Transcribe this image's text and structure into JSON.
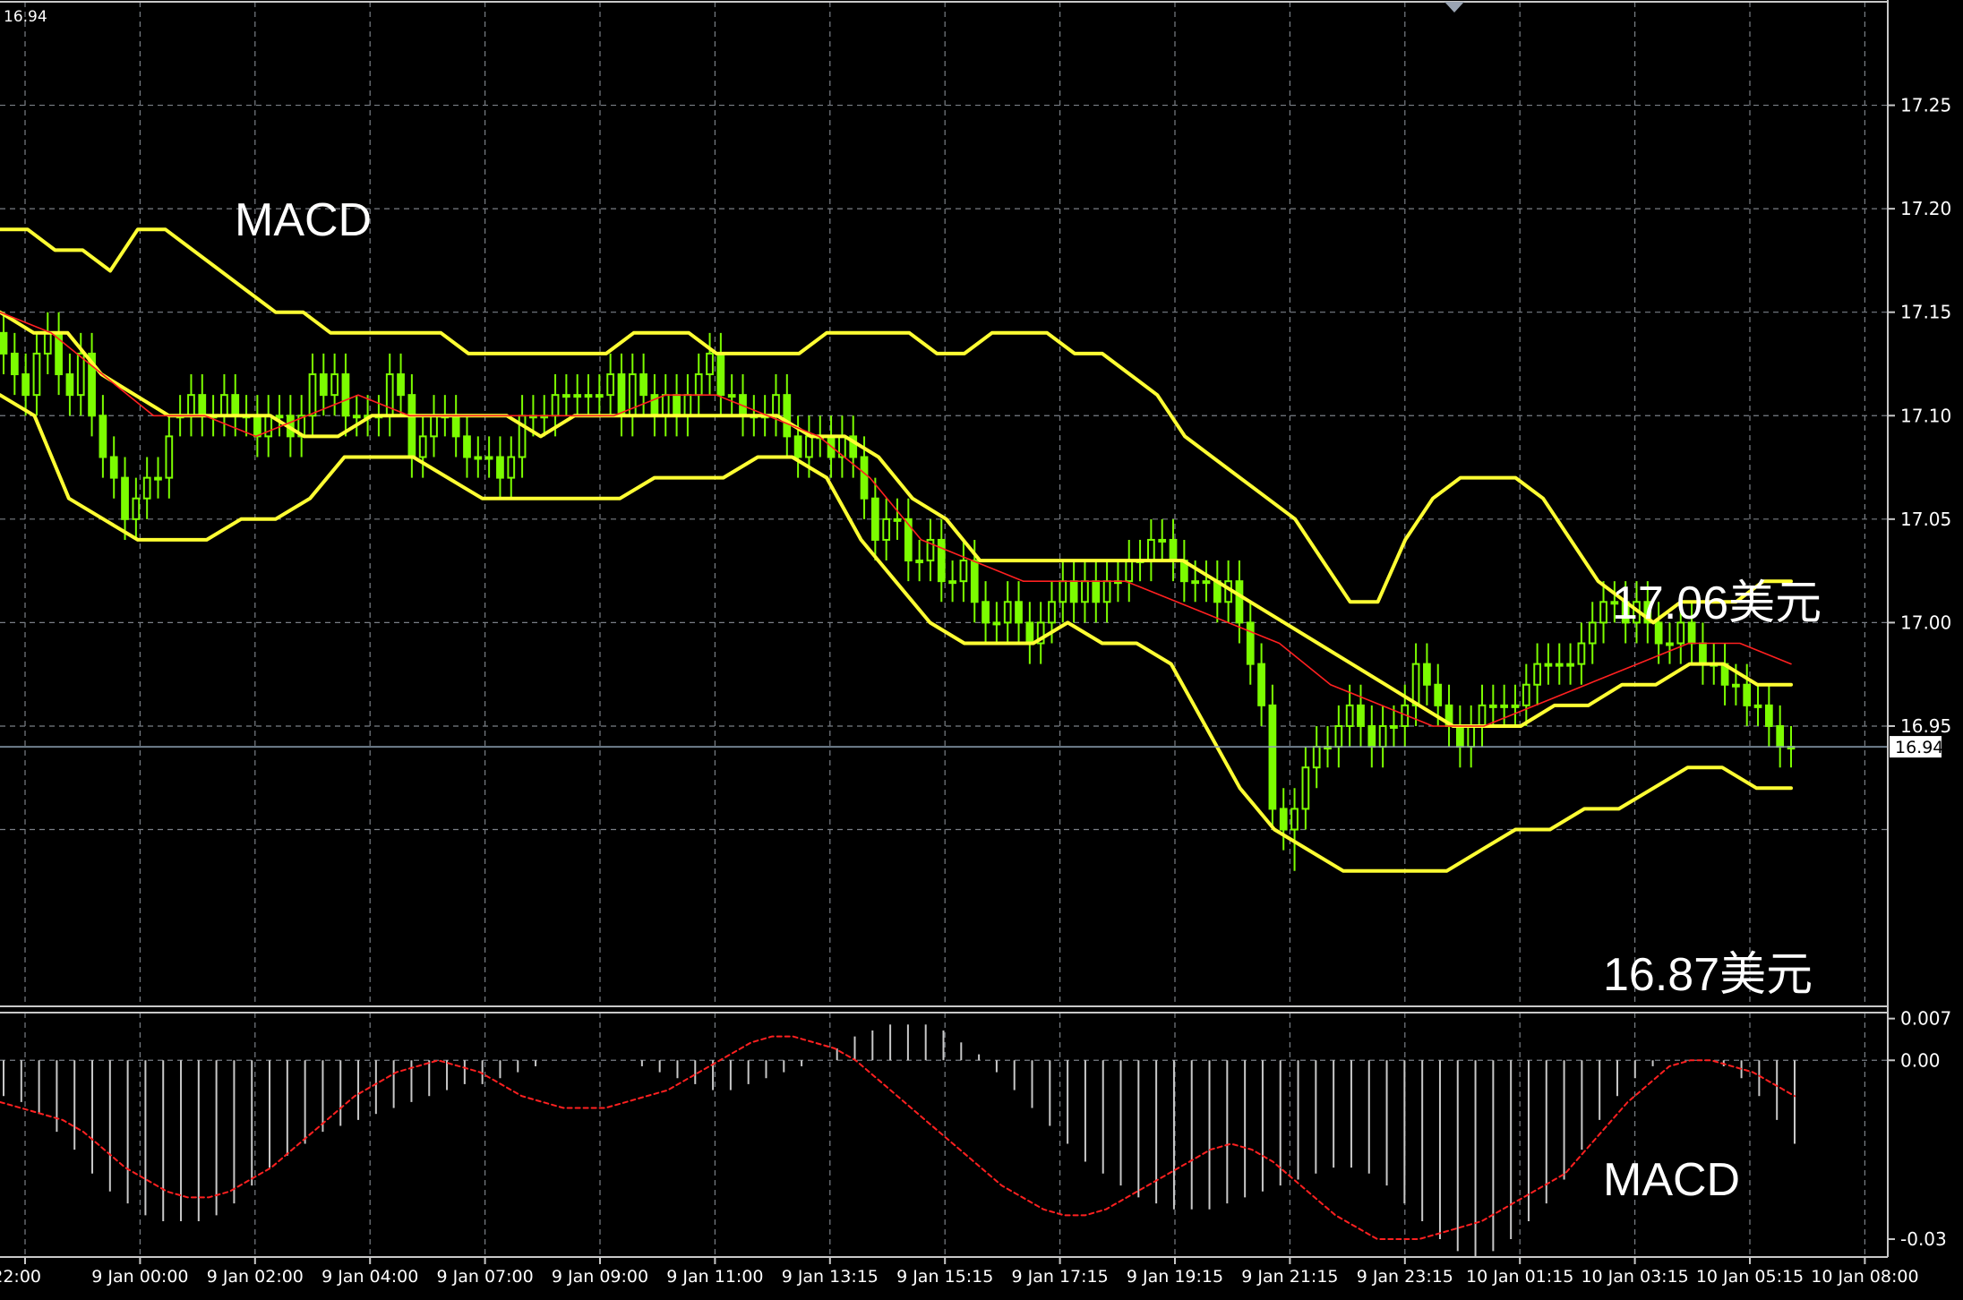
{
  "colors": {
    "background": "#000000",
    "grid": "#7a7f86",
    "frame": "#c8c8c8",
    "axis_text": "#ffffff",
    "candle": "#7CFC00",
    "bollinger": "#ffff33",
    "ma": "#ff2020",
    "histogram": "#c8c8c8",
    "signal": "#ff2020",
    "price_line": "#8fa3b5",
    "label": "#ffffff"
  },
  "annotations": {
    "macd_top": "MACD",
    "upper_price": "17.06美元",
    "lower_price": "16.87美元",
    "macd_bottom": "MACD"
  },
  "chart_data": [
    {
      "type": "candlestick",
      "corner_label": "16.94",
      "current_price": 16.94,
      "current_price_label": "16.94",
      "ylim": [
        16.815,
        17.3
      ],
      "yticks": [
        17.25,
        17.2,
        17.15,
        17.1,
        17.05,
        17.0,
        16.95
      ],
      "ytick_labels": [
        "17.25",
        "17.20",
        "17.15",
        "17.10",
        "17.05",
        "17.00",
        "16.95"
      ],
      "x_labels": [
        "22:00",
        "9 Jan 00:00",
        "9 Jan 02:00",
        "9 Jan 04:00",
        "9 Jan 07:00",
        "9 Jan 09:00",
        "9 Jan 11:00",
        "9 Jan 13:15",
        "9 Jan 15:15",
        "9 Jan 17:15",
        "9 Jan 19:15",
        "9 Jan 21:15",
        "9 Jan 23:15",
        "10 Jan 01:15",
        "10 Jan 03:15",
        "10 Jan 05:15",
        "10 Jan 08:00"
      ],
      "candles": {
        "open": [
          17.14,
          17.13,
          17.12,
          17.11,
          17.13,
          17.14,
          17.12,
          17.11,
          17.13,
          17.1,
          17.08,
          17.07,
          17.05,
          17.06,
          17.07,
          17.07,
          17.1,
          17.1,
          17.11,
          17.1,
          17.1,
          17.11,
          17.1,
          17.1,
          17.09,
          17.1,
          17.1,
          17.09,
          17.1,
          17.12,
          17.11,
          17.12,
          17.1,
          17.1,
          17.1,
          17.1,
          17.12,
          17.11,
          17.08,
          17.09,
          17.1,
          17.1,
          17.09,
          17.08,
          17.08,
          17.08,
          17.07,
          17.08,
          17.1,
          17.1,
          17.1,
          17.11,
          17.11,
          17.11,
          17.11,
          17.11,
          17.12,
          17.1,
          17.12,
          17.11,
          17.1,
          17.11,
          17.1,
          17.11,
          17.12,
          17.13,
          17.11,
          17.11,
          17.1,
          17.1,
          17.1,
          17.11,
          17.09,
          17.08,
          17.09,
          17.09,
          17.08,
          17.09,
          17.08,
          17.06,
          17.04,
          17.05,
          17.05,
          17.03,
          17.03,
          17.04,
          17.02,
          17.02,
          17.03,
          17.01,
          17.0,
          17.0,
          17.01,
          17.0,
          16.99,
          17.0,
          17.01,
          17.02,
          17.01,
          17.02,
          17.01,
          17.02,
          17.02,
          17.03,
          17.03,
          17.04,
          17.04,
          17.03,
          17.02,
          17.02,
          17.02,
          17.01,
          17.02,
          17.0,
          16.98,
          16.96,
          16.91,
          16.9,
          16.91,
          16.93,
          16.94,
          16.94,
          16.95,
          16.96,
          16.95,
          16.94,
          16.95,
          16.95,
          16.96,
          16.98,
          16.97,
          16.96,
          16.95,
          16.94,
          16.95,
          16.96,
          16.96,
          16.96,
          16.96,
          16.97,
          16.98,
          16.98,
          16.98,
          16.98,
          16.99,
          17.0,
          17.01,
          17.01,
          17.0,
          17.01,
          17.0,
          16.99,
          16.99,
          17.0,
          16.99,
          16.98,
          16.98,
          16.97,
          16.97,
          16.96,
          16.96,
          16.95,
          16.94
        ],
        "close": [
          17.13,
          17.12,
          17.11,
          17.13,
          17.14,
          17.12,
          17.11,
          17.13,
          17.1,
          17.08,
          17.07,
          17.05,
          17.06,
          17.07,
          17.07,
          17.09,
          17.1,
          17.11,
          17.1,
          17.1,
          17.11,
          17.1,
          17.1,
          17.09,
          17.1,
          17.1,
          17.09,
          17.1,
          17.12,
          17.11,
          17.12,
          17.1,
          17.1,
          17.1,
          17.1,
          17.12,
          17.11,
          17.08,
          17.09,
          17.1,
          17.1,
          17.09,
          17.08,
          17.08,
          17.08,
          17.07,
          17.08,
          17.1,
          17.1,
          17.1,
          17.11,
          17.11,
          17.11,
          17.11,
          17.11,
          17.12,
          17.1,
          17.12,
          17.11,
          17.1,
          17.11,
          17.1,
          17.11,
          17.12,
          17.13,
          17.11,
          17.11,
          17.1,
          17.1,
          17.1,
          17.11,
          17.09,
          17.08,
          17.09,
          17.09,
          17.08,
          17.09,
          17.08,
          17.06,
          17.04,
          17.05,
          17.05,
          17.03,
          17.03,
          17.04,
          17.02,
          17.02,
          17.03,
          17.01,
          17.0,
          17.0,
          17.01,
          17.0,
          16.99,
          17.0,
          17.01,
          17.02,
          17.01,
          17.02,
          17.01,
          17.02,
          17.02,
          17.03,
          17.03,
          17.04,
          17.04,
          17.03,
          17.02,
          17.02,
          17.02,
          17.01,
          17.02,
          17.0,
          16.98,
          16.96,
          16.91,
          16.9,
          16.91,
          16.93,
          16.94,
          16.94,
          16.95,
          16.96,
          16.95,
          16.94,
          16.95,
          16.95,
          16.96,
          16.98,
          16.97,
          16.96,
          16.95,
          16.94,
          16.95,
          16.96,
          16.96,
          16.96,
          16.96,
          16.97,
          16.98,
          16.98,
          16.98,
          16.98,
          16.99,
          17.0,
          17.01,
          17.01,
          17.0,
          17.01,
          17.0,
          16.99,
          16.99,
          17.0,
          16.99,
          16.98,
          16.98,
          16.97,
          16.97,
          16.96,
          16.96,
          16.95,
          16.94,
          16.94
        ],
        "high": [
          17.15,
          17.14,
          17.13,
          17.14,
          17.15,
          17.15,
          17.13,
          17.14,
          17.14,
          17.11,
          17.09,
          17.08,
          17.07,
          17.08,
          17.08,
          17.1,
          17.11,
          17.12,
          17.12,
          17.11,
          17.12,
          17.12,
          17.11,
          17.11,
          17.11,
          17.11,
          17.11,
          17.11,
          17.13,
          17.13,
          17.13,
          17.13,
          17.11,
          17.11,
          17.11,
          17.13,
          17.13,
          17.12,
          17.1,
          17.11,
          17.11,
          17.11,
          17.1,
          17.09,
          17.09,
          17.09,
          17.09,
          17.11,
          17.11,
          17.11,
          17.12,
          17.12,
          17.12,
          17.12,
          17.12,
          17.13,
          17.13,
          17.13,
          17.13,
          17.12,
          17.12,
          17.12,
          17.12,
          17.13,
          17.14,
          17.14,
          17.12,
          17.12,
          17.11,
          17.11,
          17.12,
          17.12,
          17.1,
          17.1,
          17.1,
          17.1,
          17.1,
          17.1,
          17.09,
          17.07,
          17.06,
          17.06,
          17.06,
          17.04,
          17.05,
          17.05,
          17.03,
          17.04,
          17.04,
          17.02,
          17.01,
          17.02,
          17.02,
          17.01,
          17.01,
          17.02,
          17.03,
          17.03,
          17.03,
          17.03,
          17.03,
          17.03,
          17.04,
          17.04,
          17.05,
          17.05,
          17.05,
          17.04,
          17.03,
          17.03,
          17.03,
          17.03,
          17.03,
          17.01,
          16.99,
          16.97,
          16.92,
          16.92,
          16.94,
          16.95,
          16.95,
          16.96,
          16.97,
          16.97,
          16.96,
          16.96,
          16.96,
          16.97,
          16.99,
          16.99,
          16.98,
          16.97,
          16.96,
          16.96,
          16.97,
          16.97,
          16.97,
          16.97,
          16.98,
          16.99,
          16.99,
          16.99,
          16.99,
          17.0,
          17.01,
          17.02,
          17.02,
          17.02,
          17.02,
          17.02,
          17.01,
          17.0,
          17.01,
          17.01,
          17.0,
          16.99,
          16.99,
          16.98,
          16.98,
          16.97,
          16.97,
          16.96,
          16.95
        ],
        "low": [
          17.12,
          17.11,
          17.1,
          17.1,
          17.12,
          17.11,
          17.1,
          17.1,
          17.09,
          17.07,
          17.06,
          17.04,
          17.04,
          17.05,
          17.06,
          17.06,
          17.09,
          17.09,
          17.09,
          17.09,
          17.09,
          17.09,
          17.09,
          17.08,
          17.08,
          17.09,
          17.08,
          17.08,
          17.09,
          17.1,
          17.1,
          17.09,
          17.09,
          17.09,
          17.09,
          17.09,
          17.1,
          17.07,
          17.07,
          17.08,
          17.09,
          17.08,
          17.07,
          17.07,
          17.07,
          17.06,
          17.06,
          17.07,
          17.09,
          17.09,
          17.09,
          17.1,
          17.1,
          17.1,
          17.1,
          17.1,
          17.09,
          17.09,
          17.1,
          17.09,
          17.09,
          17.09,
          17.09,
          17.1,
          17.11,
          17.1,
          17.1,
          17.09,
          17.09,
          17.09,
          17.09,
          17.08,
          17.07,
          17.07,
          17.08,
          17.07,
          17.07,
          17.07,
          17.05,
          17.03,
          17.03,
          17.04,
          17.02,
          17.02,
          17.02,
          17.01,
          17.01,
          17.01,
          17.0,
          16.99,
          16.99,
          16.99,
          16.99,
          16.98,
          16.98,
          16.99,
          17.0,
          17.0,
          17.0,
          17.0,
          17.0,
          17.01,
          17.01,
          17.02,
          17.02,
          17.03,
          17.02,
          17.01,
          17.01,
          17.01,
          17.0,
          17.0,
          16.99,
          16.97,
          16.95,
          16.9,
          16.89,
          16.88,
          16.9,
          16.92,
          16.93,
          16.93,
          16.94,
          16.94,
          16.93,
          16.93,
          16.94,
          16.94,
          16.95,
          16.96,
          16.95,
          16.94,
          16.93,
          16.93,
          16.94,
          16.95,
          16.95,
          16.95,
          16.95,
          16.96,
          16.97,
          16.97,
          16.97,
          16.97,
          16.98,
          16.99,
          17.0,
          16.99,
          16.99,
          16.99,
          16.98,
          16.98,
          16.98,
          16.98,
          16.97,
          16.97,
          16.96,
          16.96,
          16.95,
          16.95,
          16.94,
          16.93,
          16.93
        ]
      },
      "bollinger_upper": [
        17.19,
        17.19,
        17.18,
        17.18,
        17.17,
        17.19,
        17.19,
        17.18,
        17.17,
        17.16,
        17.15,
        17.15,
        17.14,
        17.14,
        17.14,
        17.14,
        17.14,
        17.13,
        17.13,
        17.13,
        17.13,
        17.13,
        17.13,
        17.14,
        17.14,
        17.14,
        17.13,
        17.13,
        17.13,
        17.13,
        17.14,
        17.14,
        17.14,
        17.14,
        17.13,
        17.13,
        17.14,
        17.14,
        17.14,
        17.13,
        17.13,
        17.12,
        17.11,
        17.09,
        17.08,
        17.07,
        17.06,
        17.05,
        17.03,
        17.01,
        17.01,
        17.04,
        17.06,
        17.07,
        17.07,
        17.07,
        17.06,
        17.04,
        17.02,
        17.01,
        17.0,
        17.01,
        17.01,
        17.01,
        17.02,
        17.02
      ],
      "bollinger_middle": [
        17.15,
        17.14,
        17.14,
        17.12,
        17.11,
        17.1,
        17.1,
        17.1,
        17.1,
        17.09,
        17.09,
        17.1,
        17.1,
        17.1,
        17.1,
        17.1,
        17.09,
        17.1,
        17.1,
        17.1,
        17.1,
        17.1,
        17.1,
        17.1,
        17.09,
        17.09,
        17.08,
        17.06,
        17.05,
        17.03,
        17.03,
        17.03,
        17.03,
        17.03,
        17.03,
        17.03,
        17.02,
        17.01,
        17.0,
        16.99,
        16.98,
        16.97,
        16.96,
        16.95,
        16.95,
        16.95,
        16.96,
        16.96,
        16.97,
        16.97,
        16.98,
        16.98,
        16.97,
        16.97
      ],
      "bollinger_lower": [
        17.11,
        17.1,
        17.06,
        17.05,
        17.04,
        17.04,
        17.04,
        17.05,
        17.05,
        17.06,
        17.08,
        17.08,
        17.08,
        17.07,
        17.06,
        17.06,
        17.06,
        17.06,
        17.06,
        17.07,
        17.07,
        17.07,
        17.08,
        17.08,
        17.07,
        17.04,
        17.02,
        17.0,
        16.99,
        16.99,
        16.99,
        17.0,
        16.99,
        16.99,
        16.98,
        16.95,
        16.92,
        16.9,
        16.89,
        16.88,
        16.88,
        16.88,
        16.88,
        16.89,
        16.9,
        16.9,
        16.91,
        16.91,
        16.92,
        16.93,
        16.93,
        16.92,
        16.92
      ],
      "ma": [
        17.15,
        17.14,
        17.12,
        17.1,
        17.1,
        17.09,
        17.1,
        17.11,
        17.1,
        17.1,
        17.1,
        17.1,
        17.1,
        17.11,
        17.11,
        17.1,
        17.09,
        17.07,
        17.04,
        17.03,
        17.02,
        17.02,
        17.02,
        17.01,
        17.0,
        16.99,
        16.97,
        16.96,
        16.95,
        16.95,
        16.96,
        16.97,
        16.98,
        16.99,
        16.99,
        16.98
      ]
    },
    {
      "type": "bar",
      "ylim": [
        -0.033,
        0.008
      ],
      "yticks": [
        0.007,
        0.0,
        -0.03
      ],
      "ytick_labels": [
        "0.007",
        "0.00",
        "-0.03"
      ],
      "histogram": [
        -0.006,
        -0.007,
        -0.009,
        -0.012,
        -0.015,
        -0.019,
        -0.022,
        -0.024,
        -0.026,
        -0.027,
        -0.027,
        -0.027,
        -0.026,
        -0.024,
        -0.021,
        -0.018,
        -0.016,
        -0.014,
        -0.012,
        -0.011,
        -0.01,
        -0.009,
        -0.008,
        -0.007,
        -0.006,
        -0.005,
        -0.004,
        -0.004,
        -0.003,
        -0.002,
        -0.001,
        0.0,
        0.0,
        0.0,
        0.0,
        0.0,
        -0.001,
        -0.002,
        -0.003,
        -0.004,
        -0.005,
        -0.005,
        -0.004,
        -0.003,
        -0.002,
        -0.001,
        0.0,
        0.002,
        0.004,
        0.005,
        0.006,
        0.006,
        0.006,
        0.005,
        0.003,
        0.001,
        -0.002,
        -0.005,
        -0.008,
        -0.011,
        -0.014,
        -0.017,
        -0.019,
        -0.021,
        -0.023,
        -0.024,
        -0.025,
        -0.025,
        -0.025,
        -0.024,
        -0.023,
        -0.022,
        -0.021,
        -0.02,
        -0.019,
        -0.018,
        -0.018,
        -0.019,
        -0.021,
        -0.024,
        -0.027,
        -0.03,
        -0.032,
        -0.033,
        -0.032,
        -0.03,
        -0.027,
        -0.024,
        -0.02,
        -0.015,
        -0.01,
        -0.006,
        -0.003,
        -0.001,
        0.0,
        0.0,
        0.0,
        -0.001,
        -0.003,
        -0.006,
        -0.01,
        -0.014
      ],
      "signal": [
        -0.007,
        -0.008,
        -0.009,
        -0.01,
        -0.012,
        -0.015,
        -0.018,
        -0.02,
        -0.022,
        -0.023,
        -0.023,
        -0.022,
        -0.02,
        -0.018,
        -0.015,
        -0.012,
        -0.009,
        -0.006,
        -0.004,
        -0.002,
        -0.001,
        0.0,
        -0.001,
        -0.002,
        -0.004,
        -0.006,
        -0.007,
        -0.008,
        -0.008,
        -0.008,
        -0.007,
        -0.006,
        -0.005,
        -0.003,
        -0.001,
        0.001,
        0.003,
        0.004,
        0.004,
        0.003,
        0.002,
        0.0,
        -0.003,
        -0.006,
        -0.009,
        -0.012,
        -0.015,
        -0.018,
        -0.021,
        -0.023,
        -0.025,
        -0.026,
        -0.026,
        -0.025,
        -0.023,
        -0.021,
        -0.019,
        -0.017,
        -0.015,
        -0.014,
        -0.015,
        -0.017,
        -0.02,
        -0.023,
        -0.026,
        -0.028,
        -0.03,
        -0.03,
        -0.03,
        -0.029,
        -0.028,
        -0.027,
        -0.025,
        -0.023,
        -0.021,
        -0.019,
        -0.015,
        -0.011,
        -0.007,
        -0.004,
        -0.001,
        0.0,
        0.0,
        -0.001,
        -0.002,
        -0.004,
        -0.006
      ]
    }
  ]
}
